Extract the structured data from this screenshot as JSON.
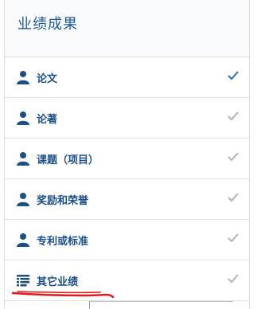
{
  "panel": {
    "title": "业绩成果"
  },
  "menu": {
    "items": [
      {
        "label": "论文",
        "icon": "user-icon",
        "check": "active"
      },
      {
        "label": "论著",
        "icon": "user-icon",
        "check": "inactive"
      },
      {
        "label": "课题（项目）",
        "icon": "user-icon",
        "check": "inactive"
      },
      {
        "label": "奖励和荣誉",
        "icon": "user-icon",
        "check": "inactive"
      },
      {
        "label": "专利或标准",
        "icon": "user-icon",
        "check": "inactive"
      },
      {
        "label": "其它业绩",
        "icon": "list-icon",
        "check": "inactive"
      }
    ]
  },
  "colors": {
    "accent": "#1b4f87",
    "check_active": "#1e73c0",
    "check_inactive": "#b3b3b3",
    "annotation": "#e01b1b"
  }
}
